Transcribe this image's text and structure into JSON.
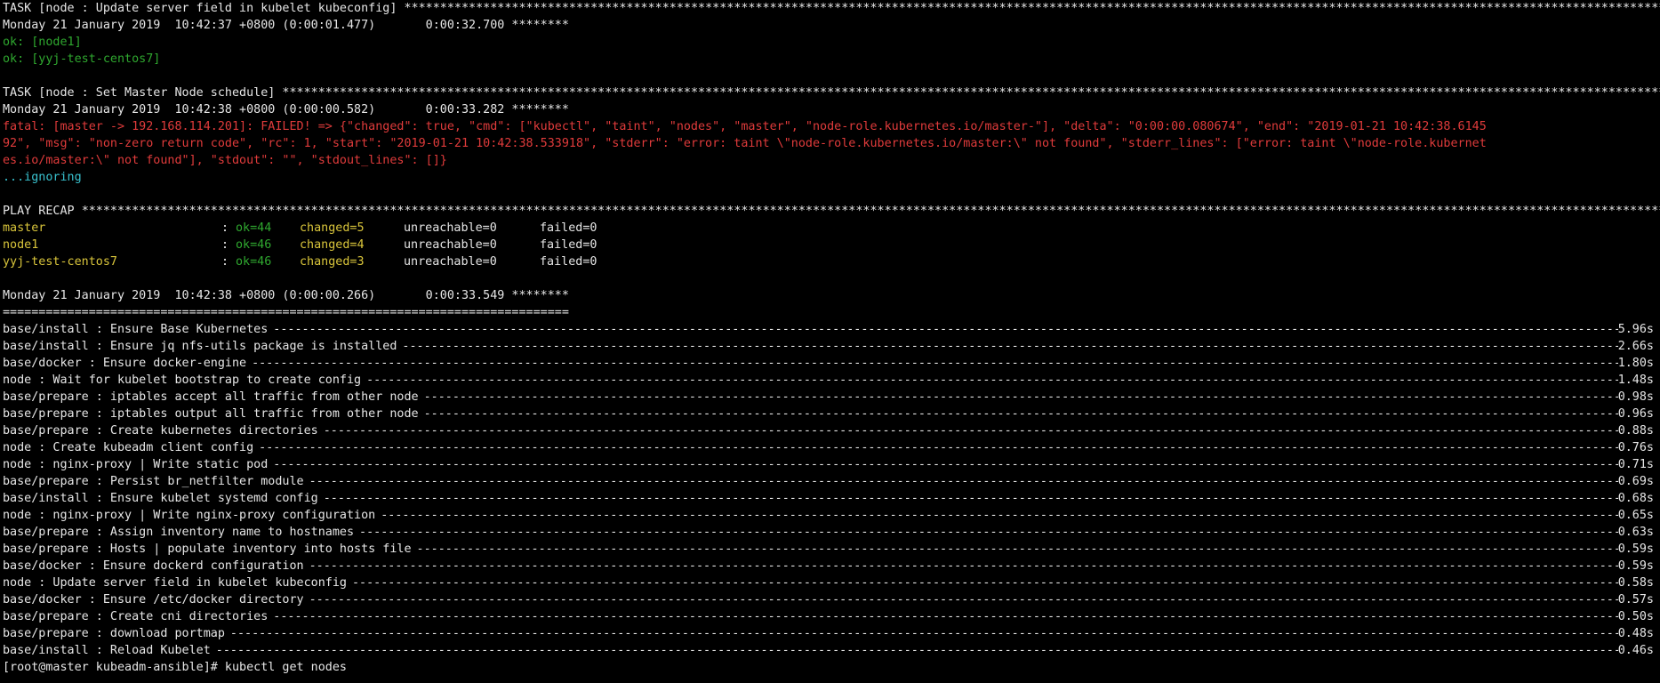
{
  "colors": {
    "background": "#000000",
    "text": "#e6e6e6",
    "ok": "#2fa82f",
    "error": "#e03b3b",
    "info": "#39c2cf",
    "warn": "#d9c53b"
  },
  "task1": {
    "header": "TASK [node : Update server field in kubelet kubeconfig] ",
    "stars": "*******************************************************************************************************************************************************************************************************************************",
    "timestamp": "Monday 21 January 2019  10:42:37 +0800 (0:00:01.477)       0:00:32.700 ********",
    "results": [
      "ok: [node1]",
      "ok: [yyj-test-centos7]"
    ]
  },
  "task2": {
    "header": "TASK [node : Set Master Node schedule] ",
    "stars": "*******************************************************************************************************************************************************************************************************************************************************",
    "timestamp": "Monday 21 January 2019  10:42:38 +0800 (0:00:00.582)       0:00:33.282 ********",
    "error_lines": [
      "fatal: [master -> 192.168.114.201]: FAILED! => {\"changed\": true, \"cmd\": [\"kubectl\", \"taint\", \"nodes\", \"master\", \"node-role.kubernetes.io/master-\"], \"delta\": \"0:00:00.080674\", \"end\": \"2019-01-21 10:42:38.6145",
      "92\", \"msg\": \"non-zero return code\", \"rc\": 1, \"start\": \"2019-01-21 10:42:38.533918\", \"stderr\": \"error: taint \\\"node-role.kubernetes.io/master:\\\" not found\", \"stderr_lines\": [\"error: taint \\\"node-role.kubernet",
      "es.io/master:\\\" not found\"], \"stdout\": \"\", \"stdout_lines\": []}"
    ],
    "ignoring": "...ignoring"
  },
  "recap": {
    "header": "PLAY RECAP ",
    "stars": "*****************************************************************************************************************************************************************************************************************************************************************",
    "rows": [
      {
        "host": "master",
        "sep": ": ",
        "ok": "ok=44",
        "changed": "changed=5",
        "unreachable": "unreachable=0",
        "failed": "failed=0"
      },
      {
        "host": "node1",
        "sep": ": ",
        "ok": "ok=46",
        "changed": "changed=4",
        "unreachable": "unreachable=0",
        "failed": "failed=0"
      },
      {
        "host": "yyj-test-centos7",
        "sep": ": ",
        "ok": "ok=46",
        "changed": "changed=3",
        "unreachable": "unreachable=0",
        "failed": "failed=0"
      }
    ],
    "timestamp": "Monday 21 January 2019  10:42:38 +0800 (0:00:00.266)       0:00:33.549 ********",
    "rule": "==============================================================================="
  },
  "profile": [
    {
      "task": "base/install : Ensure Base Kubernetes",
      "time": "5.96s"
    },
    {
      "task": "base/install : Ensure jq nfs-utils package is installed",
      "time": "2.66s"
    },
    {
      "task": "base/docker : Ensure docker-engine",
      "time": "1.80s"
    },
    {
      "task": "node : Wait for kubelet bootstrap to create config",
      "time": "1.48s"
    },
    {
      "task": "base/prepare : iptables accept all traffic from other node",
      "time": "0.98s"
    },
    {
      "task": "base/prepare : iptables output all traffic from other node",
      "time": "0.96s"
    },
    {
      "task": "base/prepare : Create kubernetes directories",
      "time": "0.88s"
    },
    {
      "task": "node : Create kubeadm client config",
      "time": "0.76s"
    },
    {
      "task": "node : nginx-proxy | Write static pod",
      "time": "0.71s"
    },
    {
      "task": "base/prepare : Persist br_netfilter module",
      "time": "0.69s"
    },
    {
      "task": "base/install : Ensure kubelet systemd config",
      "time": "0.68s"
    },
    {
      "task": "node : nginx-proxy | Write nginx-proxy configuration",
      "time": "0.65s"
    },
    {
      "task": "base/prepare : Assign inventory name to hostnames",
      "time": "0.63s"
    },
    {
      "task": "base/prepare : Hosts | populate inventory into hosts file",
      "time": "0.59s"
    },
    {
      "task": "base/docker : Ensure dockerd configuration",
      "time": "0.59s"
    },
    {
      "task": "node : Update server field in kubelet kubeconfig",
      "time": "0.58s"
    },
    {
      "task": "base/docker : Ensure /etc/docker directory",
      "time": "0.57s"
    },
    {
      "task": "base/prepare : Create cni directories",
      "time": "0.50s"
    },
    {
      "task": "base/prepare : download portmap",
      "time": "0.48s"
    },
    {
      "task": "base/install : Reload Kubelet",
      "time": "0.46s"
    }
  ],
  "prompt": {
    "text": "[root@master kubeadm-ansible]# ",
    "command": "kubectl get nodes"
  },
  "dashes": "----------------------------------------------------------------------------------------------------------------------------------------------------------------------------------------------------------------------------------------------------------------"
}
